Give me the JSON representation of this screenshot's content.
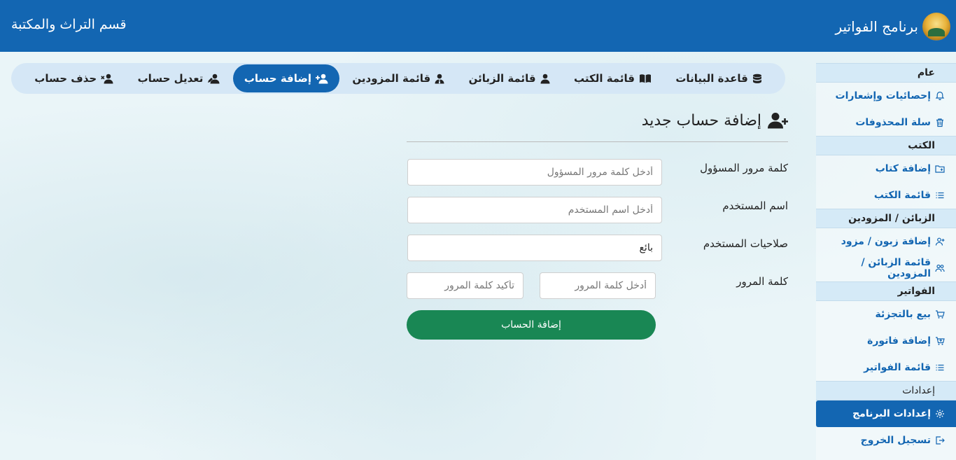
{
  "header": {
    "app_title": "برنامج الفواتير",
    "department": "قسم التراث والمكتبة"
  },
  "sidebar": {
    "sections": [
      {
        "title": "عام",
        "items": [
          {
            "label": "إحصائيات وإشعارات",
            "icon": "bell-icon"
          },
          {
            "label": "سلة المحذوفات",
            "icon": "trash-icon"
          }
        ]
      },
      {
        "title": "الكتب",
        "items": [
          {
            "label": "إضافة كتاب",
            "icon": "folder-plus-icon"
          },
          {
            "label": "قائمة الكتب",
            "icon": "list-icon"
          }
        ]
      },
      {
        "title": "الزبائن / المزودين",
        "items": [
          {
            "label": "إضافة زبون / مزود",
            "icon": "user-plus-icon"
          },
          {
            "label": "قائمة الزبائن / المزودين",
            "icon": "users-icon"
          }
        ]
      },
      {
        "title": "الفواتير",
        "items": [
          {
            "label": "بيع بالتجزئة",
            "icon": "cart-icon"
          },
          {
            "label": "إضافة فاتورة",
            "icon": "cart-plus-icon"
          },
          {
            "label": "قائمة الفواتير",
            "icon": "list-icon"
          }
        ]
      },
      {
        "title": "إعدادات",
        "items": [
          {
            "label": "إعدادات البرنامج",
            "icon": "gear-icon",
            "active": true
          },
          {
            "label": "تسجيل الخروج",
            "icon": "logout-icon"
          }
        ]
      }
    ]
  },
  "tabs": [
    {
      "label": "قاعدة البيانات",
      "icon": "database-icon"
    },
    {
      "label": "قائمة الكتب",
      "icon": "book-icon"
    },
    {
      "label": "قائمة الزبائن",
      "icon": "user-icon"
    },
    {
      "label": "قائمة المزودين",
      "icon": "user-tie-icon"
    },
    {
      "label": "إضافة حساب",
      "icon": "user-plus-icon",
      "active": true
    },
    {
      "label": "تعديل حساب",
      "icon": "user-edit-icon"
    },
    {
      "label": "حذف حساب",
      "icon": "user-times-icon"
    }
  ],
  "form": {
    "title": "إضافة حساب جديد",
    "admin_password": {
      "label": "كلمة مرور المسؤول",
      "placeholder": "أدخل كلمة مرور المسؤول",
      "value": ""
    },
    "username": {
      "label": "اسم المستخدم",
      "placeholder": "أدخل اسم المستخدم",
      "value": ""
    },
    "permissions": {
      "label": "صلاحيات المستخدم",
      "value": "بائع"
    },
    "password": {
      "label": "كلمة المرور",
      "placeholder": "أدخل كلمة المرور",
      "confirm_placeholder": "تأكيد كلمة المرور"
    },
    "submit_label": "إضافة الحساب"
  },
  "colors": {
    "primary": "#1366b2",
    "success": "#198754",
    "section_bg": "#d5eaf7",
    "tabs_bg": "#d5e7f6"
  }
}
